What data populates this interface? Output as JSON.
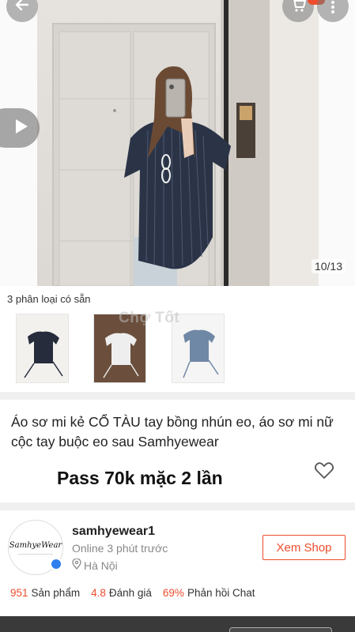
{
  "gallery": {
    "counter": "10/13"
  },
  "variants": {
    "label": "3 phân loại có sẵn",
    "watermark": "Chợ Tốt"
  },
  "product": {
    "title": "Áo sơ mi kẻ CỔ TÀU tay bồng nhún eo, áo sơ mi nữ cộc tay buộc eo sau Samhyewear",
    "promo": "Pass 70k mặc 2 lần"
  },
  "shop": {
    "logo_text": "SamhyeWear",
    "name": "samhyewear1",
    "status": "Online 3 phút trước",
    "location": "Hà Nội",
    "view_shop_label": "Xem Shop"
  },
  "stats": [
    {
      "value": "951",
      "label": "Sản phẩm"
    },
    {
      "value": "4.8",
      "label": "Đánh giá"
    },
    {
      "value": "69%",
      "label": "Phản hồi Chat"
    }
  ],
  "colors": {
    "accent": "#ee4d2d",
    "verified": "#2f80ed"
  },
  "icons": [
    "back-arrow-icon",
    "cart-icon",
    "more-vertical-icon",
    "play-icon",
    "heart-icon",
    "location-pin-icon",
    "verified-icon"
  ]
}
